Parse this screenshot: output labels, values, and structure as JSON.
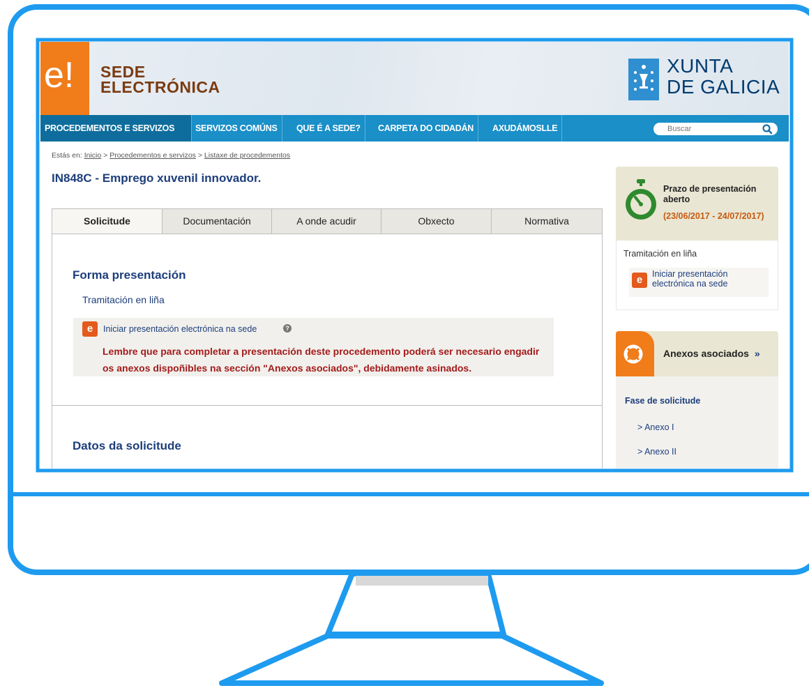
{
  "header": {
    "logo_mark": "e!",
    "site_title_line1": "SEDE",
    "site_title_line2": "ELECTRÓNICA",
    "org_line1": "XUNTA",
    "org_line2": "DE GALICIA"
  },
  "nav": {
    "items": [
      {
        "label": "PROCEDEMENTOS E SERVIZOS"
      },
      {
        "label": "SERVIZOS COMÚNS"
      },
      {
        "label": "QUE É A SEDE?"
      },
      {
        "label": "CARPETA DO CIDADÁN"
      },
      {
        "label": "AXUDÁMOSLLE"
      }
    ],
    "search_placeholder": "Buscar"
  },
  "breadcrumb": {
    "prefix": "Estás en:",
    "items": [
      "Inicio",
      "Procedementos e servizos",
      "Listaxe de procedementos"
    ],
    "separator": ">"
  },
  "page_title": "IN848C - Emprego xuvenil innovador.",
  "tabs": [
    {
      "label": "Solicitude"
    },
    {
      "label": "Documentación"
    },
    {
      "label": "A onde acudir"
    },
    {
      "label": "Obxecto"
    },
    {
      "label": "Normativa"
    }
  ],
  "main": {
    "forma_heading": "Forma presentación",
    "tramitacion_label": "Tramitación en liña",
    "notice_link": "Iniciar presentación electrónica na sede",
    "notice_warning": "Lembre que para completar a presentación deste procedemento poderá ser necesario engadir os anexos dispoñibles na sección \"Anexos asociados\", debidamente asinados.",
    "datos_heading": "Datos da solicitude"
  },
  "sidebar": {
    "prazo_title": "Prazo de presentación aberto",
    "prazo_dates": "(23/06/2017 - 24/07/2017)",
    "tram_label": "Tramitación en liña",
    "tram_link": "Iniciar presentación electrónica na sede",
    "anexos_title": "Anexos asociados",
    "anexos_chevron": "»",
    "fase_label": "Fase de solicitude",
    "anexos": [
      "> Anexo I",
      "> Anexo II"
    ]
  },
  "colors": {
    "monitor_frame": "#1e9bef",
    "nav_bg": "#1a8fc8",
    "accent_orange": "#f07c1a",
    "title_blue": "#1d3e7c",
    "warning_red": "#a31b1b"
  }
}
